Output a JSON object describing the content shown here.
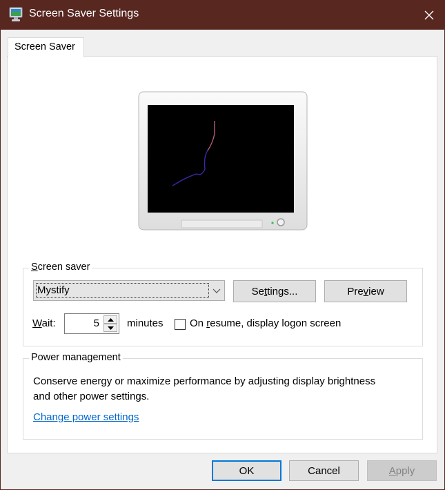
{
  "window": {
    "title": "Screen Saver Settings",
    "icon": "screen-saver-monitor-icon",
    "close_icon": "close-icon",
    "frame_color": "#572720"
  },
  "tabs": [
    {
      "label": "Screen Saver",
      "active": true
    }
  ],
  "preview": {
    "description": "Monitor preview showing Mystify screen saver on black screen"
  },
  "screen_saver_group": {
    "label": "Screen saver",
    "mnemonic": "S",
    "selected": "Mystify",
    "settings_button": "Settings...",
    "preview_button": "Preview",
    "wait_label": "Wait:",
    "wait_value": "5",
    "minutes_label": "minutes",
    "on_resume_label": "On resume, display logon screen",
    "on_resume_checked": false
  },
  "power_group": {
    "label": "Power management",
    "description": "Conserve energy or maximize performance by adjusting display brightness and other power settings.",
    "link": "Change power settings"
  },
  "footer": {
    "ok": "OK",
    "cancel": "Cancel",
    "apply": "Apply",
    "apply_enabled": false
  },
  "colors": {
    "link": "#0066cc",
    "focus": "#0078d7"
  }
}
